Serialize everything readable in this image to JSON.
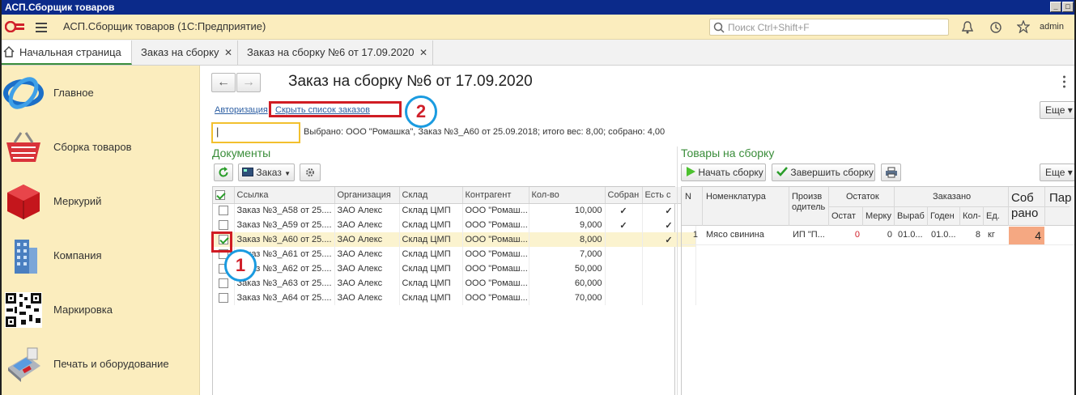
{
  "window": {
    "title": "АСП.Сборщик товаров",
    "btn_min": "_",
    "btn_max": "□",
    "btn_close": "×"
  },
  "appbar": {
    "app_title": "АСП.Сборщик товаров  (1С:Предприятие)",
    "search_placeholder": "Поиск Ctrl+Shift+F",
    "user": "admin"
  },
  "tabs": [
    {
      "label": "Начальная страница"
    },
    {
      "label": "Заказ на сборку"
    },
    {
      "label": "Заказ на сборку №6 от 17.09.2020"
    }
  ],
  "sidebar": {
    "items": [
      {
        "label": "Главное"
      },
      {
        "label": "Сборка товаров"
      },
      {
        "label": "Меркурий"
      },
      {
        "label": "Компания"
      },
      {
        "label": "Маркировка"
      },
      {
        "label": "Печать и оборудование"
      }
    ]
  },
  "form": {
    "title": "Заказ на сборку №6 от 17.09.2020",
    "link_auth": "Авторизация",
    "link_hide": "Скрыть список заказов",
    "more": "Еще ▾",
    "input_value": "|",
    "selection_info": "Выбрано: ООО \"Ромашка\", Заказ №3_А60 от 25.09.2018; итого вес: 8,00; собрано: 4,00"
  },
  "documents": {
    "section_title": "Документы",
    "order_button": "Заказ",
    "columns": [
      "Ссылка",
      "Организация",
      "Склад",
      "Контрагент",
      "Кол-во",
      "Собран",
      "Есть с"
    ],
    "rows": [
      {
        "checked": false,
        "ref": "Заказ №3_А58 от 25....",
        "org": "ЗАО Алекс",
        "wh": "Склад ЦМП",
        "cp": "ООО \"Ромаш...",
        "qty": "10,000",
        "done": "✓",
        "avail": "✓"
      },
      {
        "checked": false,
        "ref": "Заказ №3_А59 от 25....",
        "org": "ЗАО Алекс",
        "wh": "Склад ЦМП",
        "cp": "ООО \"Ромаш...",
        "qty": "9,000",
        "done": "✓",
        "avail": "✓"
      },
      {
        "checked": true,
        "ref": "Заказ №3_А60 от 25....",
        "org": "ЗАО Алекс",
        "wh": "Склад ЦМП",
        "cp": "ООО \"Ромаш...",
        "qty": "8,000",
        "done": "",
        "avail": "✓"
      },
      {
        "checked": false,
        "ref": "Заказ №3_А61 от 25....",
        "org": "ЗАО Алекс",
        "wh": "Склад ЦМП",
        "cp": "ООО \"Ромаш...",
        "qty": "7,000",
        "done": "",
        "avail": ""
      },
      {
        "checked": false,
        "ref": "Заказ №3_А62 от 25....",
        "org": "ЗАО Алекс",
        "wh": "Склад ЦМП",
        "cp": "ООО \"Ромаш...",
        "qty": "50,000",
        "done": "",
        "avail": ""
      },
      {
        "checked": false,
        "ref": "Заказ №3_А63 от 25....",
        "org": "ЗАО Алекс",
        "wh": "Склад ЦМП",
        "cp": "ООО \"Ромаш...",
        "qty": "60,000",
        "done": "",
        "avail": ""
      },
      {
        "checked": false,
        "ref": "Заказ №3_А64 от 25....",
        "org": "ЗАО Алекс",
        "wh": "Склад ЦМП",
        "cp": "ООО \"Ромаш...",
        "qty": "70,000",
        "done": "",
        "avail": ""
      }
    ]
  },
  "goods": {
    "section_title": "Товары на сборку",
    "start_button": "Начать сборку",
    "finish_button": "Завершить сборку",
    "more": "Еще ▾",
    "headers": {
      "num": "N",
      "nom": "Номенклатура",
      "prod1": "Произв",
      "prod2": "одитель",
      "stock": "Остаток",
      "stock_a": "Остат",
      "stock_b": "Мерку",
      "ordered": "Заказано",
      "ord_a": "Выраб",
      "ord_b": "Годен",
      "ord_c": "Кол-",
      "ord_d": "Ед.",
      "collected1": "Соб",
      "collected2": "рано",
      "par": "Пар"
    },
    "rows": [
      {
        "n": "1",
        "nom": "Мясо свинина",
        "prod": "ИП \"П...",
        "st_a": "0",
        "st_b": "0",
        "made": "01.0...",
        "valid": "01.0...",
        "qty": "8",
        "unit": "кг",
        "collected": "4"
      }
    ]
  },
  "annotations": {
    "badge1": "1",
    "badge2": "2"
  },
  "colors": {
    "accent_yellow": "#fbedbe",
    "section_green": "#3a8d3a",
    "annotation_red": "#d01c24",
    "annotation_blue": "#1a9be0"
  }
}
